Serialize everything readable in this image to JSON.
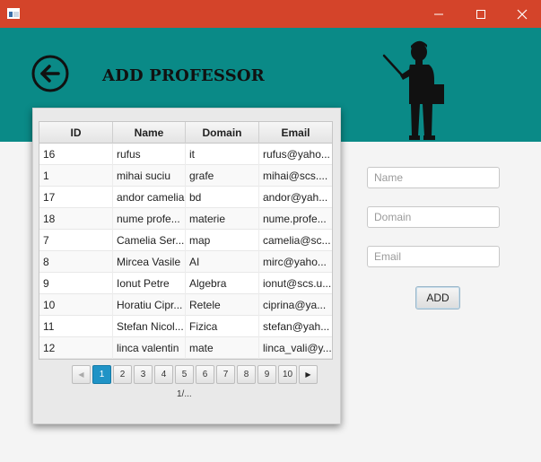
{
  "header": {
    "title": "ADD PROFESSOR"
  },
  "table": {
    "columns": [
      "ID",
      "Name",
      "Domain",
      "Email"
    ],
    "rows": [
      [
        "16",
        "rufus",
        "it",
        "rufus@yaho..."
      ],
      [
        "1",
        "mihai suciu",
        "grafe",
        "mihai@scs...."
      ],
      [
        "17",
        "andor camelia",
        "bd",
        "andor@yah..."
      ],
      [
        "18",
        "nume profe...",
        "materie",
        "nume.profe..."
      ],
      [
        "7",
        "Camelia Ser...",
        "map",
        "camelia@sc..."
      ],
      [
        "8",
        "Mircea Vasile",
        "AI",
        "mirc@yaho..."
      ],
      [
        "9",
        "Ionut Petre",
        "Algebra",
        "ionut@scs.u..."
      ],
      [
        "10",
        "Horatiu Cipr...",
        "Retele",
        "ciprina@ya..."
      ],
      [
        "11",
        "Stefan Nicol...",
        "Fizica",
        "stefan@yah..."
      ],
      [
        "12",
        "linca valentin",
        "mate",
        "linca_vali@y..."
      ]
    ]
  },
  "pagination": {
    "pages": [
      "1",
      "2",
      "3",
      "4",
      "5",
      "6",
      "7",
      "8",
      "9",
      "10"
    ],
    "current": "1",
    "prev_icon": "◀",
    "next_icon": "▶",
    "info": "1/..."
  },
  "form": {
    "name_placeholder": "Name",
    "domain_placeholder": "Domain",
    "email_placeholder": "Email",
    "add_label": "ADD"
  },
  "colors": {
    "titlebar": "#d4442a",
    "header": "#0a8a87",
    "active_page": "#1f93c6"
  },
  "icons": {
    "back": "back-arrow-circle-icon",
    "professor": "professor-pointer-icon"
  }
}
